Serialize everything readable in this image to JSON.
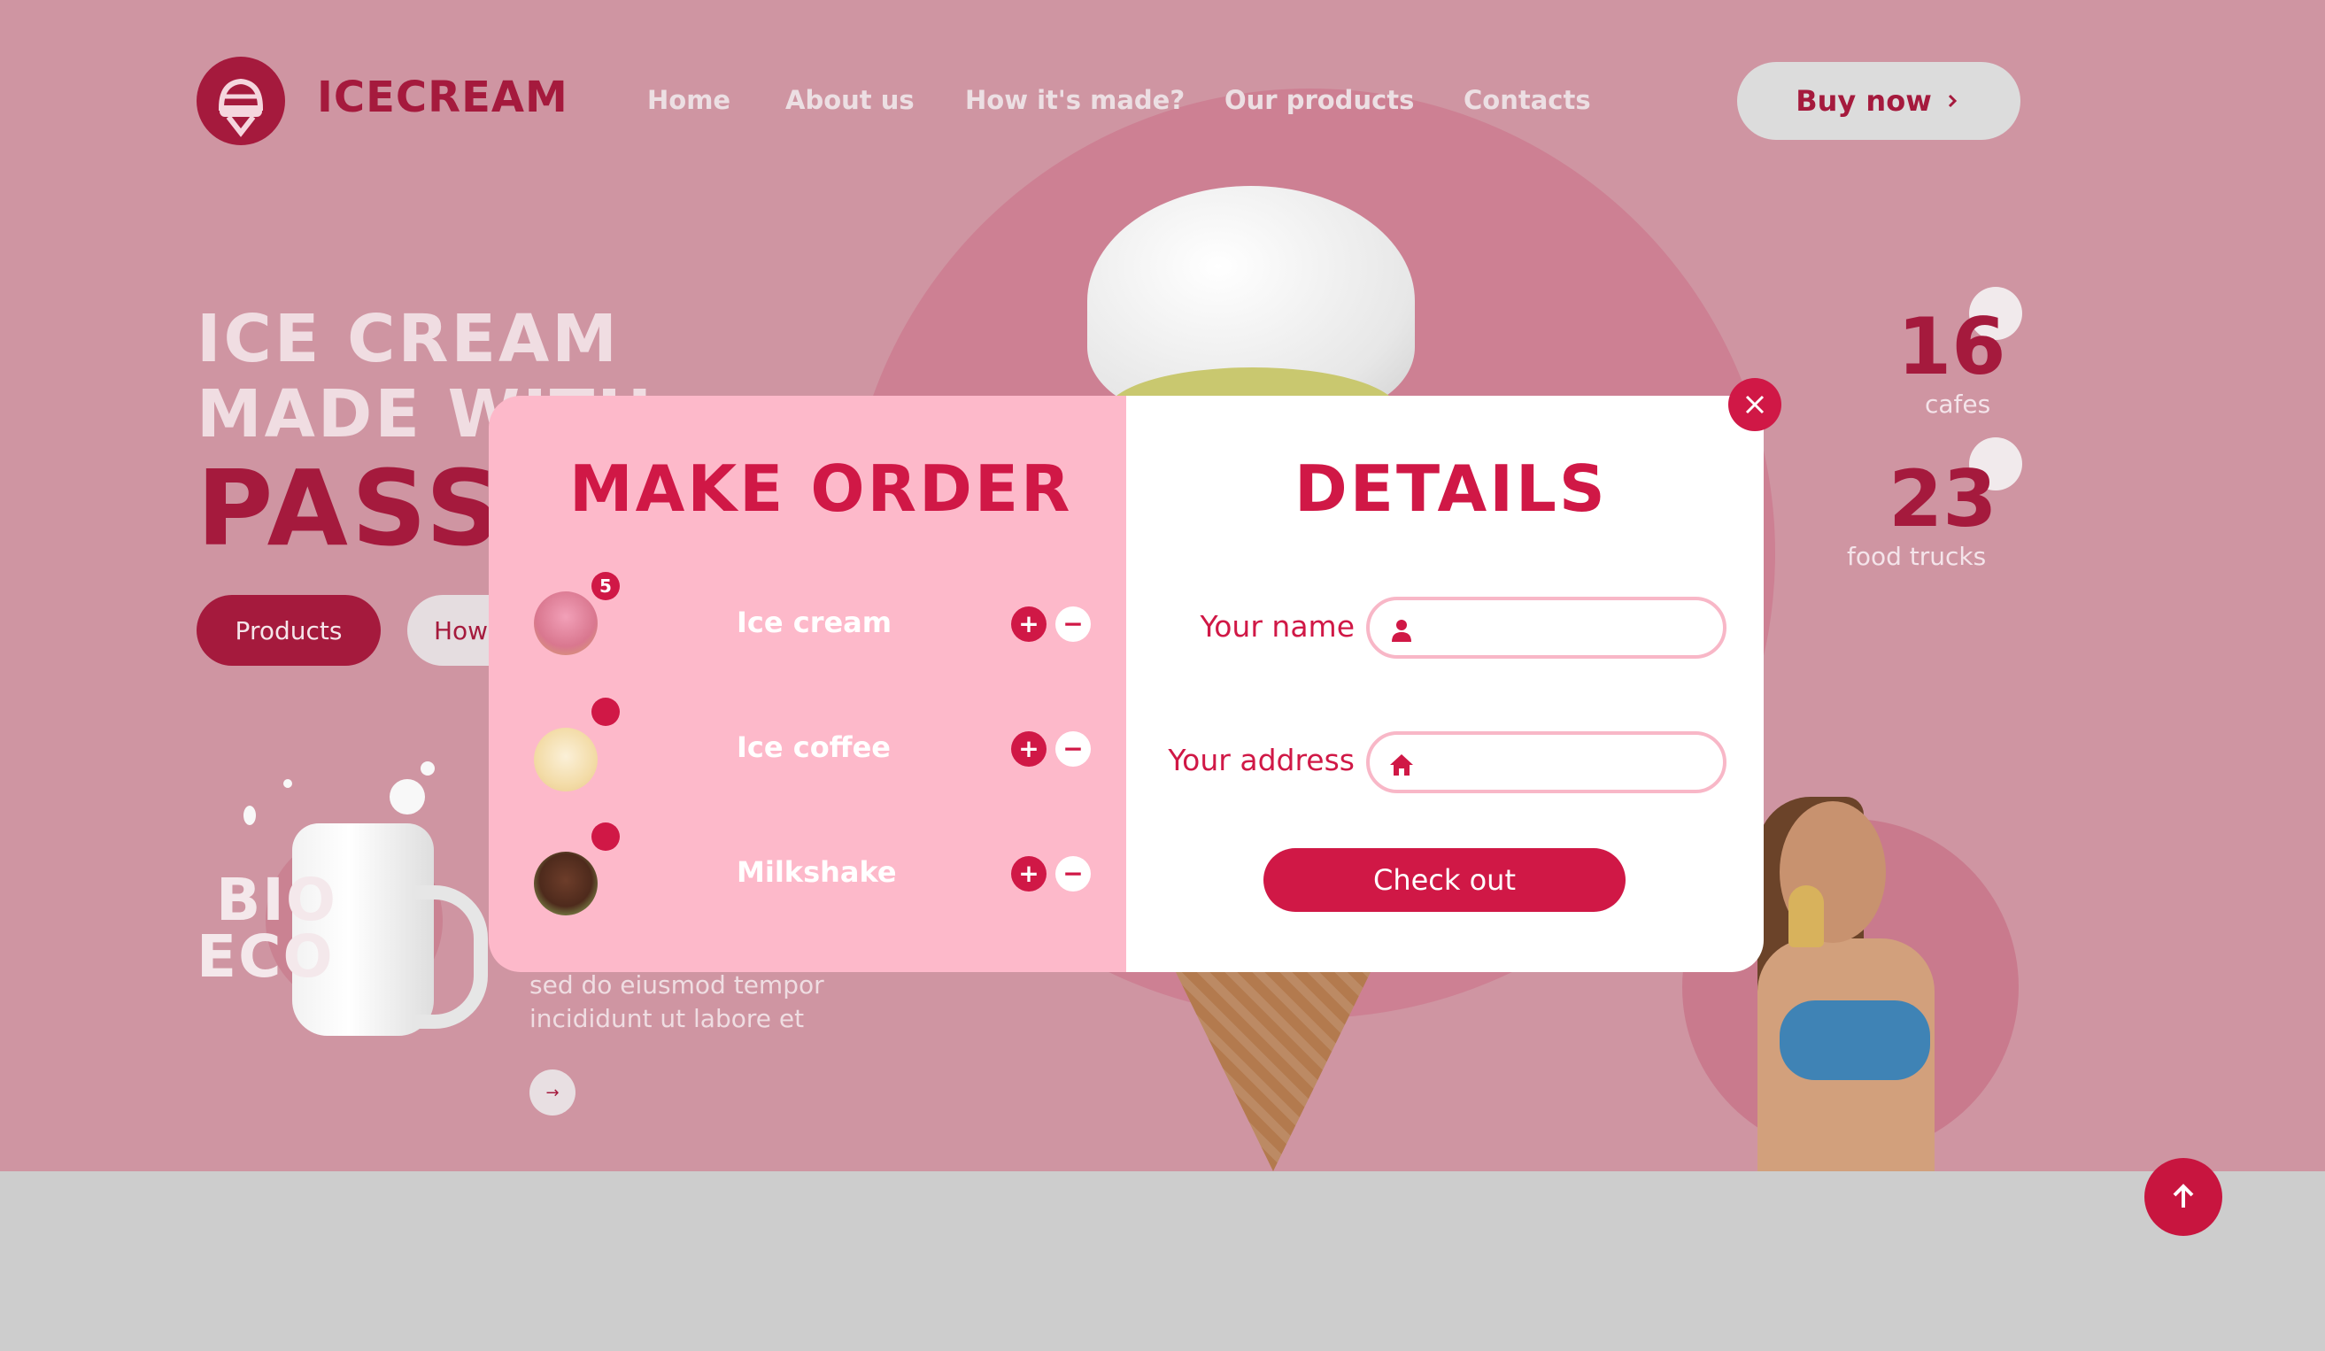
{
  "header": {
    "brand": "ICECREAM",
    "nav": [
      {
        "label": "Home"
      },
      {
        "label": "About us"
      },
      {
        "label": "How it's made?"
      },
      {
        "label": "Our products"
      },
      {
        "label": "Contacts"
      }
    ],
    "buy_label": "Buy now",
    "buy_icon": "chevron-right-icon"
  },
  "hero": {
    "line1": "ICE CREAM",
    "line2": "MADE WITH",
    "line3": "PASSION",
    "products_button": "Products",
    "how_button": "How",
    "bio_line1": "BIO",
    "bio_line2": "ECO",
    "lorem_line1": "sed do eiusmod tempor",
    "lorem_line2": "incididunt ut labore et"
  },
  "stats": [
    {
      "number": "16",
      "label": "cafes"
    },
    {
      "number": "23",
      "label": "food trucks"
    }
  ],
  "order": {
    "title": "MAKE ORDER",
    "items": [
      {
        "name": "Ice cream",
        "badge": "5"
      },
      {
        "name": "Ice coffee",
        "badge": ""
      },
      {
        "name": "Milkshake",
        "badge": ""
      }
    ],
    "plus_symbol": "+",
    "minus_symbol": "−"
  },
  "details": {
    "title": "DETAILS",
    "name_label": "Your name",
    "name_value": "",
    "address_label": "Your address",
    "address_value": "",
    "checkout_label": "Check out"
  },
  "colors": {
    "accent": "#d01846",
    "brand": "#a51a3d",
    "modal_left_bg": "#fdb9ca",
    "hero_bg": "#cf95a2"
  }
}
